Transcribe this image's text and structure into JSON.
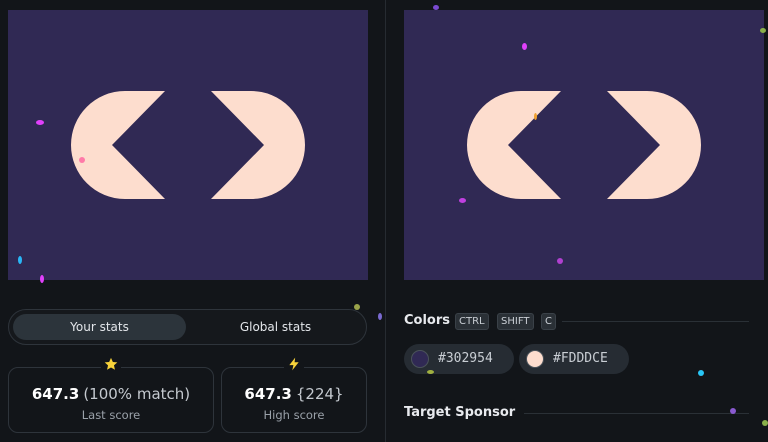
{
  "shape": {
    "background_color": "#302954",
    "foreground_color": "#FDDDCE"
  },
  "stats_tabs": {
    "your_stats": "Your stats",
    "global_stats": "Global stats"
  },
  "last_score": {
    "icon": "star-icon",
    "value": "647.3",
    "detail": "(100% match)",
    "label": "Last score"
  },
  "high_score": {
    "icon": "lightning-icon",
    "value": "647.3",
    "detail": "{224}",
    "label": "High score"
  },
  "colors_section": {
    "title": "Colors",
    "shortcut_keys": [
      "CTRL",
      "SHIFT",
      "C"
    ],
    "swatches": [
      {
        "hex": "#302954",
        "label": "#302954"
      },
      {
        "hex": "#FDDDCE",
        "label": "#FDDDCE"
      }
    ]
  },
  "sponsor_section": {
    "title": "Target Sponsor"
  }
}
